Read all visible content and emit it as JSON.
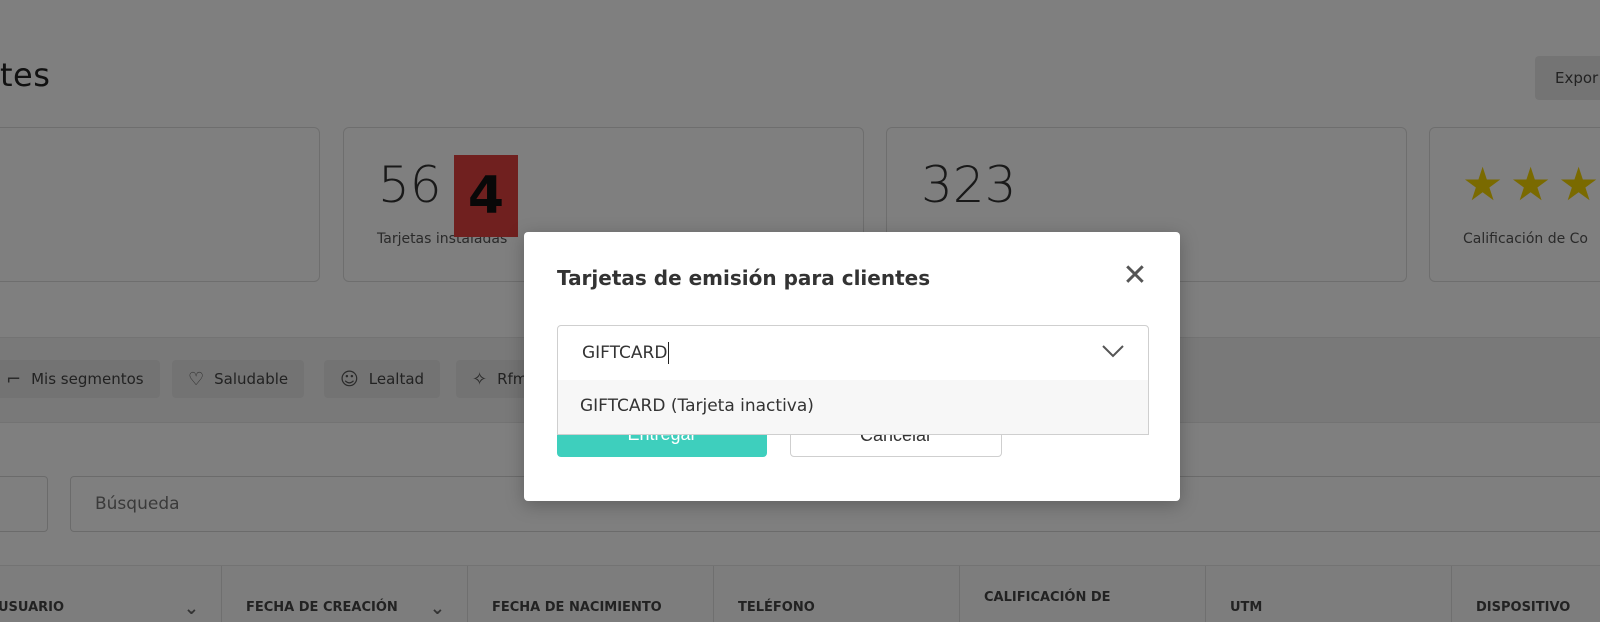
{
  "header": {
    "title": "tes",
    "export_label": "Expor"
  },
  "stats": [
    {
      "value": "",
      "label": ""
    },
    {
      "value": "56",
      "label": "Tarjetas instaladas"
    },
    {
      "value": "323",
      "label": ""
    },
    {
      "value": "",
      "label": "Calificación de Co",
      "stars": 3
    }
  ],
  "step_badge": "4",
  "filters": [
    {
      "label": "Mis segmentos",
      "icon": "segments-icon"
    },
    {
      "label": "Saludable",
      "icon": "heart-icon"
    },
    {
      "label": "Lealtad",
      "icon": "smiley-icon"
    },
    {
      "label": "Rfm",
      "icon": "rfm-icon"
    }
  ],
  "search": {
    "placeholder": "Búsqueda"
  },
  "table": {
    "columns": [
      "USUARIO",
      "FECHA DE CREACIÓN",
      "FECHA DE NACIMIENTO",
      "TELÉFONO",
      "CALIFICACIÓN DE",
      "UTM",
      "DISPOSITIVO"
    ]
  },
  "modal": {
    "title": "Tarjetas de emisión para clientes",
    "dropdown_value": "GIFTCARD",
    "options": [
      "GIFTCARD (Tarjeta inactiva)"
    ],
    "deliver_label": "Entregar",
    "cancel_label": "Cancelar"
  },
  "colors": {
    "accent": "#3ecfbd",
    "badge": "#e0403e",
    "star": "#f4d400"
  }
}
